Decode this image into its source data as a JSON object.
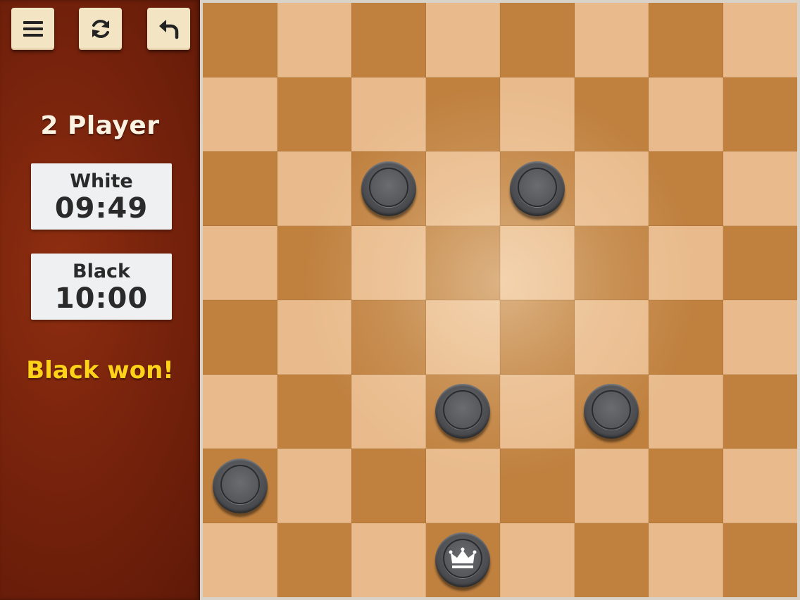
{
  "toolbar": {
    "menu_icon": "menu-icon",
    "restart_icon": "refresh-icon",
    "undo_icon": "undo-icon"
  },
  "game": {
    "mode": "2 Player",
    "status": "Black won!",
    "status_color": "#ffd21a"
  },
  "clocks": {
    "white": {
      "label": "White",
      "time": "09:49"
    },
    "black": {
      "label": "Black",
      "time": "10:00"
    }
  },
  "board": {
    "size": 8,
    "light_color": "#e9bb8c",
    "dark_color": "#c0813f",
    "pieces": [
      {
        "color": "black",
        "row": 2,
        "col": 2,
        "king": false
      },
      {
        "color": "black",
        "row": 2,
        "col": 4,
        "king": false
      },
      {
        "color": "black",
        "row": 5,
        "col": 3,
        "king": false
      },
      {
        "color": "black",
        "row": 5,
        "col": 5,
        "king": false
      },
      {
        "color": "black",
        "row": 6,
        "col": 0,
        "king": false
      },
      {
        "color": "black",
        "row": 7,
        "col": 3,
        "king": true
      }
    ]
  }
}
